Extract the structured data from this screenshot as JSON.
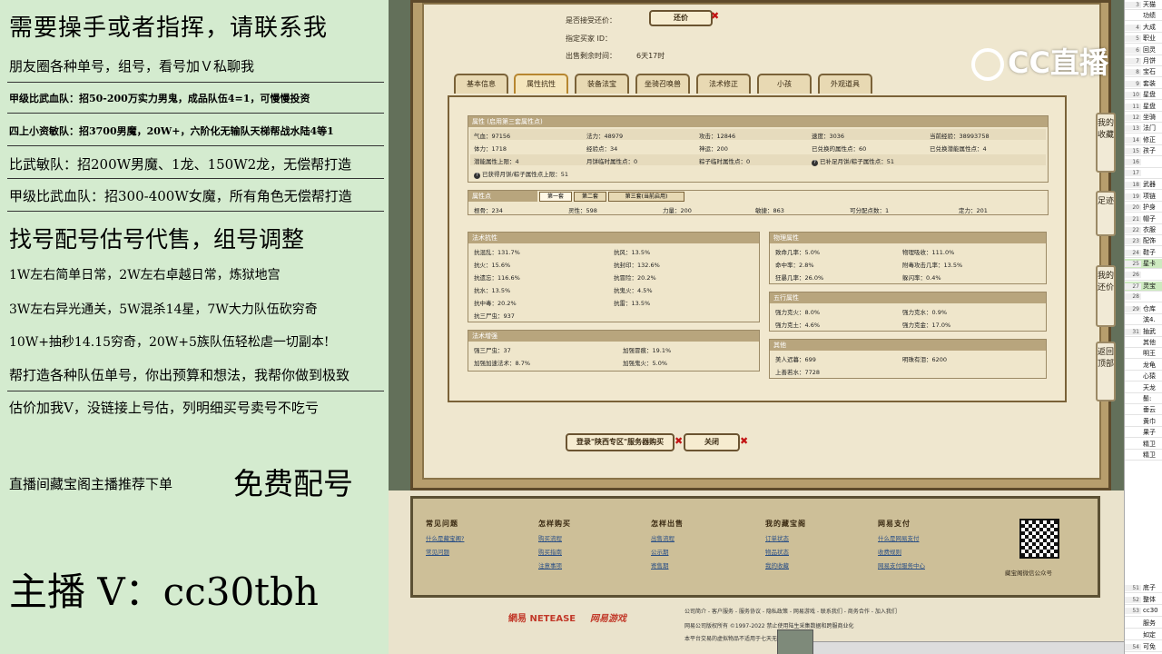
{
  "promo": {
    "line1": "需要操手或者指挥，请联系我",
    "line2": "朋友圈各种单号，组号，看号加Ｖ私聊我",
    "line3": "甲级比武血队：招50-200万实力男鬼，成品队伍4=1，可慢慢投资",
    "line4": "四上小资敏队：招3700男魔，20W+，六阶化无输队天梯帮战水陆4等1",
    "line5": "比武敏队：招200W男魔、1龙、150W2龙，无偿帮打造",
    "line6": "甲级比武血队：招300-400W女魔，所有角色无偿帮打造",
    "line7": "找号配号估号代售，组号调整",
    "line8": "1W左右简单日常，2W左右卓越日常，炼狱地宫",
    "line9": "3W左右异光通关，5W混杀14星，7W大力队伍砍穷奇",
    "line10": "10W+抽秒14.15穷奇，20W+5族队伍轻松虐一切副本!",
    "line11": "帮打造各种队伍单号，你出预算和想法，我帮你做到极致",
    "line12": "估价加我V，没链接上号估，列明细买号卖号不吃亏",
    "line13a": "直播间藏宝阁主播推荐下单",
    "line13b": "免费配号",
    "line14": "主播 V：cc30tbh"
  },
  "top": {
    "accept_label": "是否接受还价：",
    "counter_button": "还价",
    "buyer_label": "指定买家 ID：",
    "time_label": "出售剩余时间：",
    "time_value": "6天17时"
  },
  "tabs": [
    "基本信息",
    "属性抗性",
    "装备法宝",
    "坐骑召唤兽",
    "法术修正",
    "小孩",
    "外观道具"
  ],
  "attr": {
    "header": "属性 (启用第三套属性点)",
    "r1": [
      "气血：97156",
      "法力：48979",
      "攻击：12846",
      "速度：3036",
      "当前经验：38993758"
    ],
    "r2": [
      "体力：1718",
      "经验点：34",
      "神运：200",
      "已兑换的属性点：60",
      "已兑换潜能属性点：4"
    ],
    "r3": [
      "潜能属性上限：4",
      "月饼临时属性点：0",
      "粽子临时属性点：0",
      "已补足月饼/粽子属性点：51"
    ],
    "r4": "已获得月饼/粽子属性点上限：51"
  },
  "points": {
    "header": "属性点",
    "subtabs": [
      "第一套",
      "第二套",
      "第三套(当前启用)"
    ],
    "row": [
      "根骨：234",
      "灵性：598",
      "力量：200",
      "敏捷：863",
      "可分配点数：1",
      "定力：201"
    ]
  },
  "resist": {
    "header": "法术抗性",
    "cells": [
      "抗混乱：131.7%",
      "抗风：13.5%",
      "抗火：15.6%",
      "抗封印：132.6%",
      "抗遗忘：116.6%",
      "抗冒险：20.2%",
      "抗水：13.5%",
      "抗鬼火：4.5%",
      "抗中毒：20.2%",
      "抗雷：13.5%",
      "抗三尸虫：937"
    ]
  },
  "enhance": {
    "header": "法术增强",
    "cells": [
      "强三尸虫：37",
      "加强冒痕：19.1%",
      "加强加速法术：8.7%",
      "加强鬼火：5.0%"
    ]
  },
  "phys": {
    "header": "物理属性",
    "cells": [
      "致命几率：5.0%",
      "物理吸收：111.0%",
      "命中率：2.8%",
      "附毒攻击几率：13.5%",
      "狂暴几率：26.0%",
      "躲闪率：0.4%"
    ]
  },
  "five": {
    "header": "五行属性",
    "cells": [
      "强力克火：8.0%",
      "强力克水：0.9%",
      "强力克土：4.6%",
      "强力克金：17.0%"
    ]
  },
  "other": {
    "header": "其他",
    "cells": [
      "美人迟暮：699",
      "明珠有泪：6200",
      "上善若水：7728"
    ]
  },
  "actions": {
    "login": "登录\"陕西专区\"服务器购买",
    "close": "关闭"
  },
  "footer": {
    "cols": [
      {
        "title": "常见问题",
        "links": [
          "什么是藏宝阁?",
          "常见问题"
        ]
      },
      {
        "title": "怎样购买",
        "links": [
          "购买流程",
          "购买指南",
          "注意事项"
        ]
      },
      {
        "title": "怎样出售",
        "links": [
          "出售流程",
          "公示期",
          "寄售期"
        ]
      },
      {
        "title": "我的藏宝阁",
        "links": [
          "订单状态",
          "物品状态",
          "我的收藏"
        ]
      },
      {
        "title": "网易支付",
        "links": [
          "什么是网易支付",
          "收费规则",
          "网易支付服务中心"
        ]
      }
    ],
    "qr_label": "藏宝阁微信公众号",
    "brand1": "網易 NETEASE",
    "brand2": "网易游戏",
    "links": "公司简介 - 客户服务 - 服务协议 - 隐私政策 - 网易游戏 - 联系我们 - 商务合作 - 加入我们",
    "copyright": "网易公司版权所有 ©1997-2022  禁止使用陆生采集数据和跨服商业化",
    "notice": "本平台交易的虚拟物品不适用于七天无理由退货"
  },
  "sidebar": [
    "我的收藏",
    "足迹",
    "我的还价",
    "返回顶部"
  ],
  "watermark": "CC直播",
  "sheet": [
    {
      "n": "3",
      "v": "天猫"
    },
    {
      "n": "",
      "v": "功绩"
    },
    {
      "n": "4",
      "v": "大成"
    },
    {
      "n": "5",
      "v": "职业"
    },
    {
      "n": "6",
      "v": "回灵"
    },
    {
      "n": "7",
      "v": "月饼"
    },
    {
      "n": "8",
      "v": "宝石"
    },
    {
      "n": "9",
      "v": "套装"
    },
    {
      "n": "10",
      "v": "星盘"
    },
    {
      "n": "11",
      "v": "星盘"
    },
    {
      "n": "12",
      "v": "坐骑"
    },
    {
      "n": "13",
      "v": "法门"
    },
    {
      "n": "14",
      "v": "修正"
    },
    {
      "n": "15",
      "v": "孩子"
    },
    {
      "n": "16",
      "v": ""
    },
    {
      "n": "17",
      "v": ""
    },
    {
      "n": "18",
      "v": "武器"
    },
    {
      "n": "19",
      "v": "项链"
    },
    {
      "n": "20",
      "v": "护身"
    },
    {
      "n": "21",
      "v": "帽子"
    },
    {
      "n": "22",
      "v": "衣服"
    },
    {
      "n": "23",
      "v": "配饰"
    },
    {
      "n": "24",
      "v": "鞋子"
    },
    {
      "n": "25",
      "v": "星卡"
    },
    {
      "n": "26",
      "v": ""
    },
    {
      "n": "27",
      "v": "灵宝"
    },
    {
      "n": "28",
      "v": ""
    },
    {
      "n": "29",
      "v": "仓库"
    },
    {
      "n": "",
      "v": "滨4."
    },
    {
      "n": "31",
      "v": "抽武"
    },
    {
      "n": "",
      "v": "其他"
    },
    {
      "n": "",
      "v": "明王"
    },
    {
      "n": "",
      "v": "龙龟"
    },
    {
      "n": "",
      "v": "心猿"
    },
    {
      "n": "",
      "v": "天龙"
    },
    {
      "n": "",
      "v": "鬃:"
    },
    {
      "n": "",
      "v": "垂云"
    },
    {
      "n": "",
      "v": "黄巾"
    },
    {
      "n": "",
      "v": "果子"
    },
    {
      "n": "",
      "v": "精卫"
    },
    {
      "n": "",
      "v": "精卫"
    }
  ],
  "sheet_bottom": [
    {
      "n": "51",
      "v": "底子"
    },
    {
      "n": "52",
      "v": "整体"
    },
    {
      "n": "53",
      "v": "cc30"
    },
    {
      "n": "",
      "v": "服务"
    },
    {
      "n": "",
      "v": "如定"
    },
    {
      "n": "54",
      "v": "可免"
    }
  ]
}
